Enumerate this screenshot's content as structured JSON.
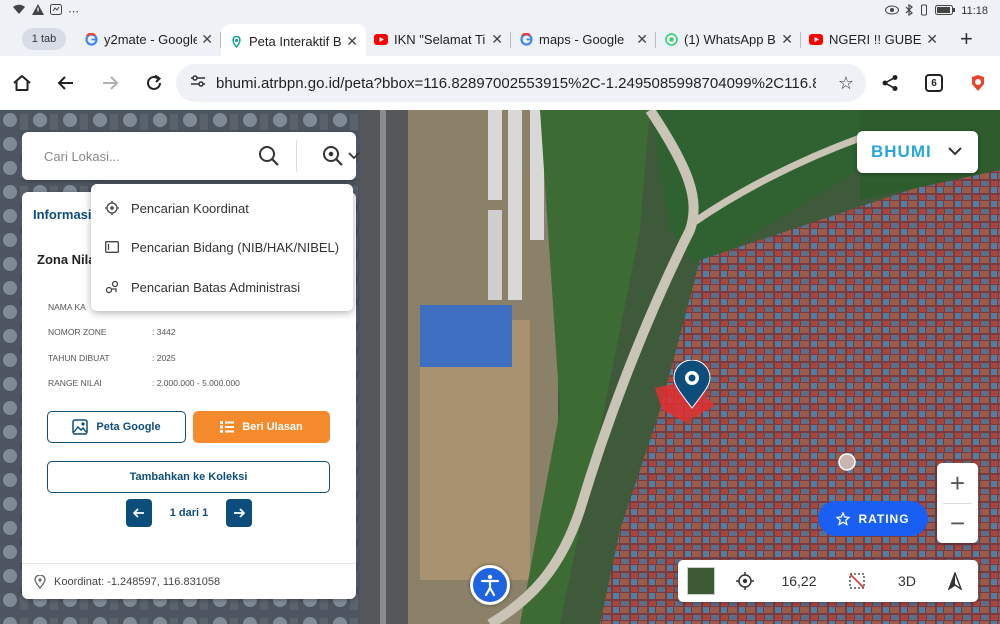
{
  "status_bar": {
    "time": "11:18"
  },
  "tabs": {
    "count_label": "1 tab",
    "items": [
      {
        "title": "y2mate - Google",
        "favicon": "google-icon",
        "active": false
      },
      {
        "title": "Peta Interaktif B",
        "favicon": "bhumi-icon",
        "active": true
      },
      {
        "title": "IKN \"Selamat Ti",
        "favicon": "youtube-icon",
        "active": false
      },
      {
        "title": "maps - Google",
        "favicon": "google-icon",
        "active": false
      },
      {
        "title": "(1) WhatsApp B",
        "favicon": "whatsapp-icon",
        "active": false
      },
      {
        "title": "NGERI !! GUBER",
        "favicon": "youtube-icon",
        "active": false
      }
    ]
  },
  "omnibox": {
    "url": "bhumi.atrbpn.go.id/peta?bbox=116.82897002553915%2C-1.2495085998704099%2C116.8",
    "tab_count": "6"
  },
  "search": {
    "placeholder": "Cari Lokasi..."
  },
  "menu": {
    "items": [
      {
        "label": "Pencarian Koordinat",
        "icon": "crosshair-icon"
      },
      {
        "label": "Pencarian Bidang (NIB/HAK/NIBEL)",
        "icon": "parcel-icon"
      },
      {
        "label": "Pencarian Batas Administrasi",
        "icon": "boundary-icon"
      }
    ]
  },
  "panel": {
    "title": "Informasi",
    "zone_title": "Zona Nilai",
    "rows": [
      {
        "key": "NAMA KA",
        "value": ""
      },
      {
        "key": "NOMOR ZONE",
        "value": ": 3442"
      },
      {
        "key": "TAHUN DIBUAT",
        "value": ": 2025"
      },
      {
        "key": "RANGE NILAI",
        "value": ": 2.000.000 - 5.000.000"
      }
    ],
    "btn_google": "Peta Google",
    "btn_review": "Beri Ulasan",
    "btn_collection": "Tambahkan ke Koleksi",
    "pager_text": "1 dari 1",
    "coordinate": "Koordinat: -1.248597, 116.831058"
  },
  "logo": {
    "text": "BHUMI"
  },
  "rating": {
    "label": "RATING"
  },
  "bottom_bar": {
    "zoom_level": "16,22",
    "mode_3d": "3D"
  },
  "colors": {
    "primary": "#0d4d7c",
    "orange": "#f58a2c",
    "rating_blue": "#1a5ff3",
    "logo_cyan": "#2aa7d8"
  }
}
